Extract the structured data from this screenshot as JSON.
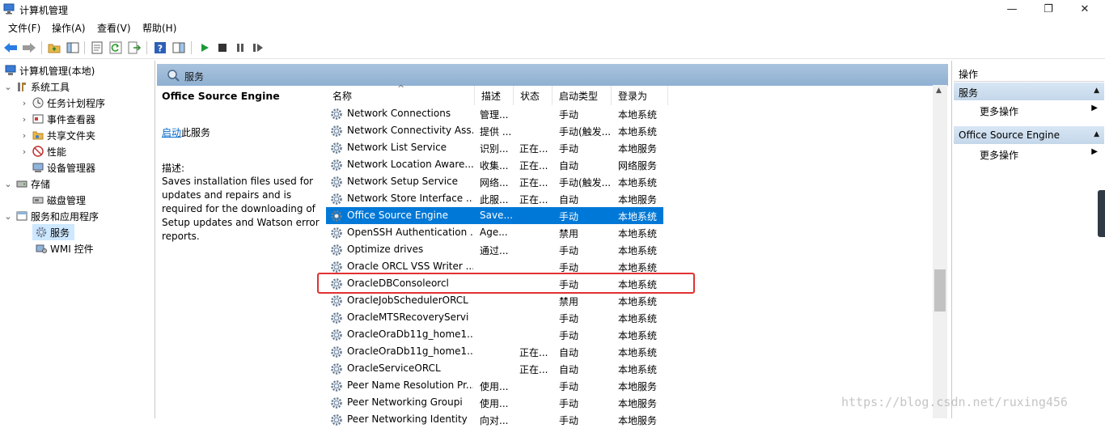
{
  "window": {
    "title": "计算机管理",
    "minimize": "—",
    "restore": "❐",
    "close": "✕"
  },
  "menu": [
    "文件(F)",
    "操作(A)",
    "查看(V)",
    "帮助(H)"
  ],
  "tree": {
    "root": "计算机管理(本地)",
    "system_tools": "系统工具",
    "task_scheduler": "任务计划程序",
    "event_viewer": "事件查看器",
    "shared_folders": "共享文件夹",
    "performance": "性能",
    "device_manager": "设备管理器",
    "storage": "存储",
    "disk_management": "磁盘管理",
    "services_apps": "服务和应用程序",
    "services": "服务",
    "wmi": "WMI 控件"
  },
  "main": {
    "header": "服务",
    "selected_title": "Office  Source Engine",
    "start_link": "启动",
    "start_suffix": "此服务",
    "desc_label": "描述:",
    "desc_text": "Saves installation files used for updates and repairs and is required for the downloading of Setup updates and Watson error reports."
  },
  "columns": {
    "name": "名称",
    "desc": "描述",
    "state": "状态",
    "startup": "启动类型",
    "logon": "登录为"
  },
  "services": [
    {
      "name": "Network Connections",
      "desc": "管理...",
      "state": "",
      "startup": "手动",
      "logon": "本地系统"
    },
    {
      "name": "Network Connectivity Ass...",
      "desc": "提供 ...",
      "state": "",
      "startup": "手动(触发...",
      "logon": "本地系统"
    },
    {
      "name": "Network List Service",
      "desc": "识别...",
      "state": "正在...",
      "startup": "手动",
      "logon": "本地服务"
    },
    {
      "name": "Network Location Aware...",
      "desc": "收集...",
      "state": "正在...",
      "startup": "自动",
      "logon": "网络服务"
    },
    {
      "name": "Network Setup Service",
      "desc": "网络...",
      "state": "正在...",
      "startup": "手动(触发...",
      "logon": "本地系统"
    },
    {
      "name": "Network Store Interface ...",
      "desc": "此服...",
      "state": "正在...",
      "startup": "自动",
      "logon": "本地服务"
    },
    {
      "name": "Office  Source Engine",
      "desc": "Save...",
      "state": "",
      "startup": "手动",
      "logon": "本地系统"
    },
    {
      "name": "OpenSSH Authentication ...",
      "desc": "Age...",
      "state": "",
      "startup": "禁用",
      "logon": "本地系统"
    },
    {
      "name": "Optimize drives",
      "desc": "通过...",
      "state": "",
      "startup": "手动",
      "logon": "本地系统"
    },
    {
      "name": "Oracle ORCL VSS Writer ...",
      "desc": "",
      "state": "",
      "startup": "手动",
      "logon": "本地系统"
    },
    {
      "name": "OracleDBConsoleorcl",
      "desc": "",
      "state": "",
      "startup": "手动",
      "logon": "本地系统"
    },
    {
      "name": "OracleJobSchedulerORCL",
      "desc": "",
      "state": "",
      "startup": "禁用",
      "logon": "本地系统"
    },
    {
      "name": "OracleMTSRecoveryServi",
      "desc": "",
      "state": "",
      "startup": "手动",
      "logon": "本地系统"
    },
    {
      "name": "OracleOraDb11g_home1...",
      "desc": "",
      "state": "",
      "startup": "手动",
      "logon": "本地系统"
    },
    {
      "name": "OracleOraDb11g_home1...",
      "desc": "",
      "state": "正在...",
      "startup": "自动",
      "logon": "本地系统"
    },
    {
      "name": "OracleServiceORCL",
      "desc": "",
      "state": "正在...",
      "startup": "自动",
      "logon": "本地系统"
    },
    {
      "name": "Peer Name Resolution Pr...",
      "desc": "使用...",
      "state": "",
      "startup": "手动",
      "logon": "本地服务"
    },
    {
      "name": "Peer Networking Groupi",
      "desc": "使用...",
      "state": "",
      "startup": "手动",
      "logon": "本地服务"
    },
    {
      "name": "Peer Networking Identity",
      "desc": "向对...",
      "state": "",
      "startup": "手动",
      "logon": "本地服务"
    }
  ],
  "actions": {
    "header": "操作",
    "section1": "服务",
    "more1": "更多操作",
    "section2": "Office  Source Engine",
    "more2": "更多操作"
  },
  "watermark": "https://blog.csdn.net/ruxing456",
  "colors": {
    "selection": "#0078d7",
    "tree_selection": "#cde8ff",
    "highlight_box": "#e23131",
    "link": "#0066cc"
  }
}
